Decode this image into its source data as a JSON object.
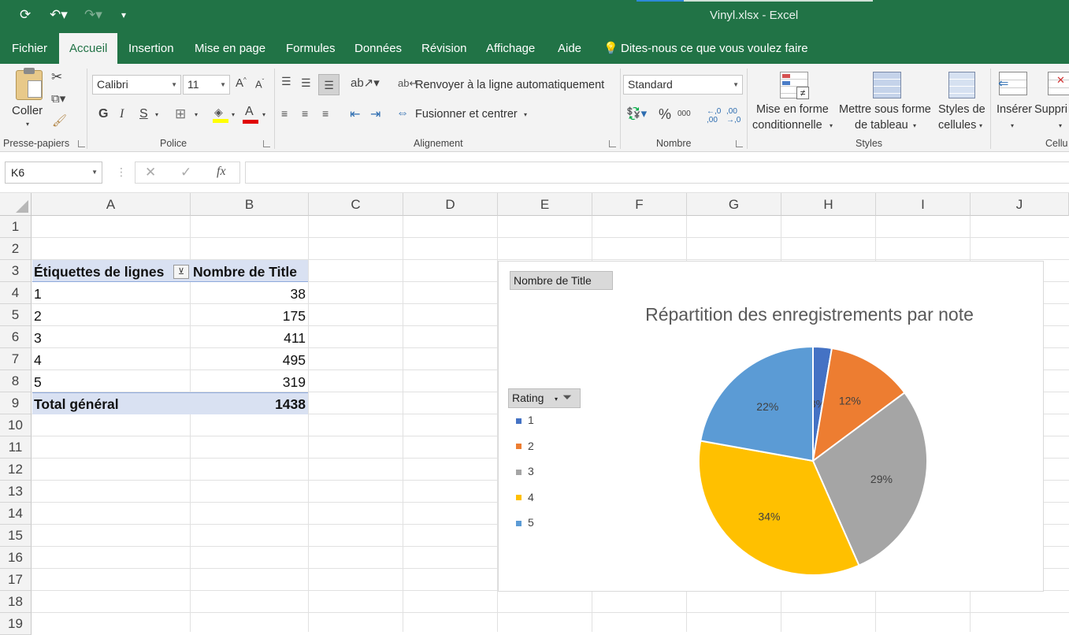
{
  "titlebar": {
    "title": "Vinyl.xlsx  -  Excel",
    "bg": "#217346"
  },
  "tabs": [
    "Fichier",
    "Accueil",
    "Insertion",
    "Mise en page",
    "Formules",
    "Données",
    "Révision",
    "Affichage",
    "Aide"
  ],
  "tell_me": "Dites-nous ce que vous voulez faire",
  "ribbon": {
    "clipboard": {
      "paste": "Coller",
      "group": "Presse-papiers"
    },
    "font": {
      "name": "Calibri",
      "size": "11",
      "bold": "G",
      "italic": "I",
      "underline": "S",
      "group": "Police"
    },
    "alignment": {
      "wrap": "Renvoyer à la ligne automatiquement",
      "merge": "Fusionner et centrer",
      "group": "Alignement"
    },
    "number": {
      "format": "Standard",
      "percent": "%",
      "thousands": "000",
      "group": "Nombre"
    },
    "styles": {
      "cond_line1": "Mise en forme",
      "cond_line2": "conditionnelle",
      "table_line1": "Mettre sous forme",
      "table_line2": "de tableau",
      "cell_line1": "Styles de",
      "cell_line2": "cellules",
      "group": "Styles"
    },
    "cells": {
      "insert": "Insérer",
      "delete": "Suppri",
      "group": "Cellu"
    }
  },
  "formula_bar": {
    "name_box": "K6",
    "fx": "fx",
    "value": ""
  },
  "columns": [
    "A",
    "B",
    "C",
    "D",
    "E",
    "F",
    "G",
    "H",
    "I",
    "J"
  ],
  "rows": [
    "1",
    "2",
    "3",
    "4",
    "5",
    "6",
    "7",
    "8",
    "9",
    "10",
    "11",
    "12",
    "13",
    "14",
    "15",
    "16",
    "17",
    "18",
    "19"
  ],
  "pivot": {
    "header_labels": "Étiquettes de lignes",
    "header_values": "Nombre de Title",
    "rows": [
      {
        "label": "1",
        "value": "38"
      },
      {
        "label": "2",
        "value": "175"
      },
      {
        "label": "3",
        "value": "411"
      },
      {
        "label": "4",
        "value": "495"
      },
      {
        "label": "5",
        "value": "319"
      }
    ],
    "total_label": "Total général",
    "total_value": "1438"
  },
  "chart_field_button": "Nombre de Title",
  "legend_field_button": "Rating",
  "chart_data": {
    "type": "pie",
    "title": "Répartition des enregistrements par note",
    "categories": [
      "1",
      "2",
      "3",
      "4",
      "5"
    ],
    "values": [
      38,
      175,
      411,
      495,
      319
    ],
    "labels": [
      "3%",
      "12%",
      "29%",
      "34%",
      "22%"
    ],
    "colors": [
      "#4472C4",
      "#ED7D31",
      "#A5A5A5",
      "#FFC000",
      "#5B9BD5"
    ],
    "legend_position": "left"
  }
}
